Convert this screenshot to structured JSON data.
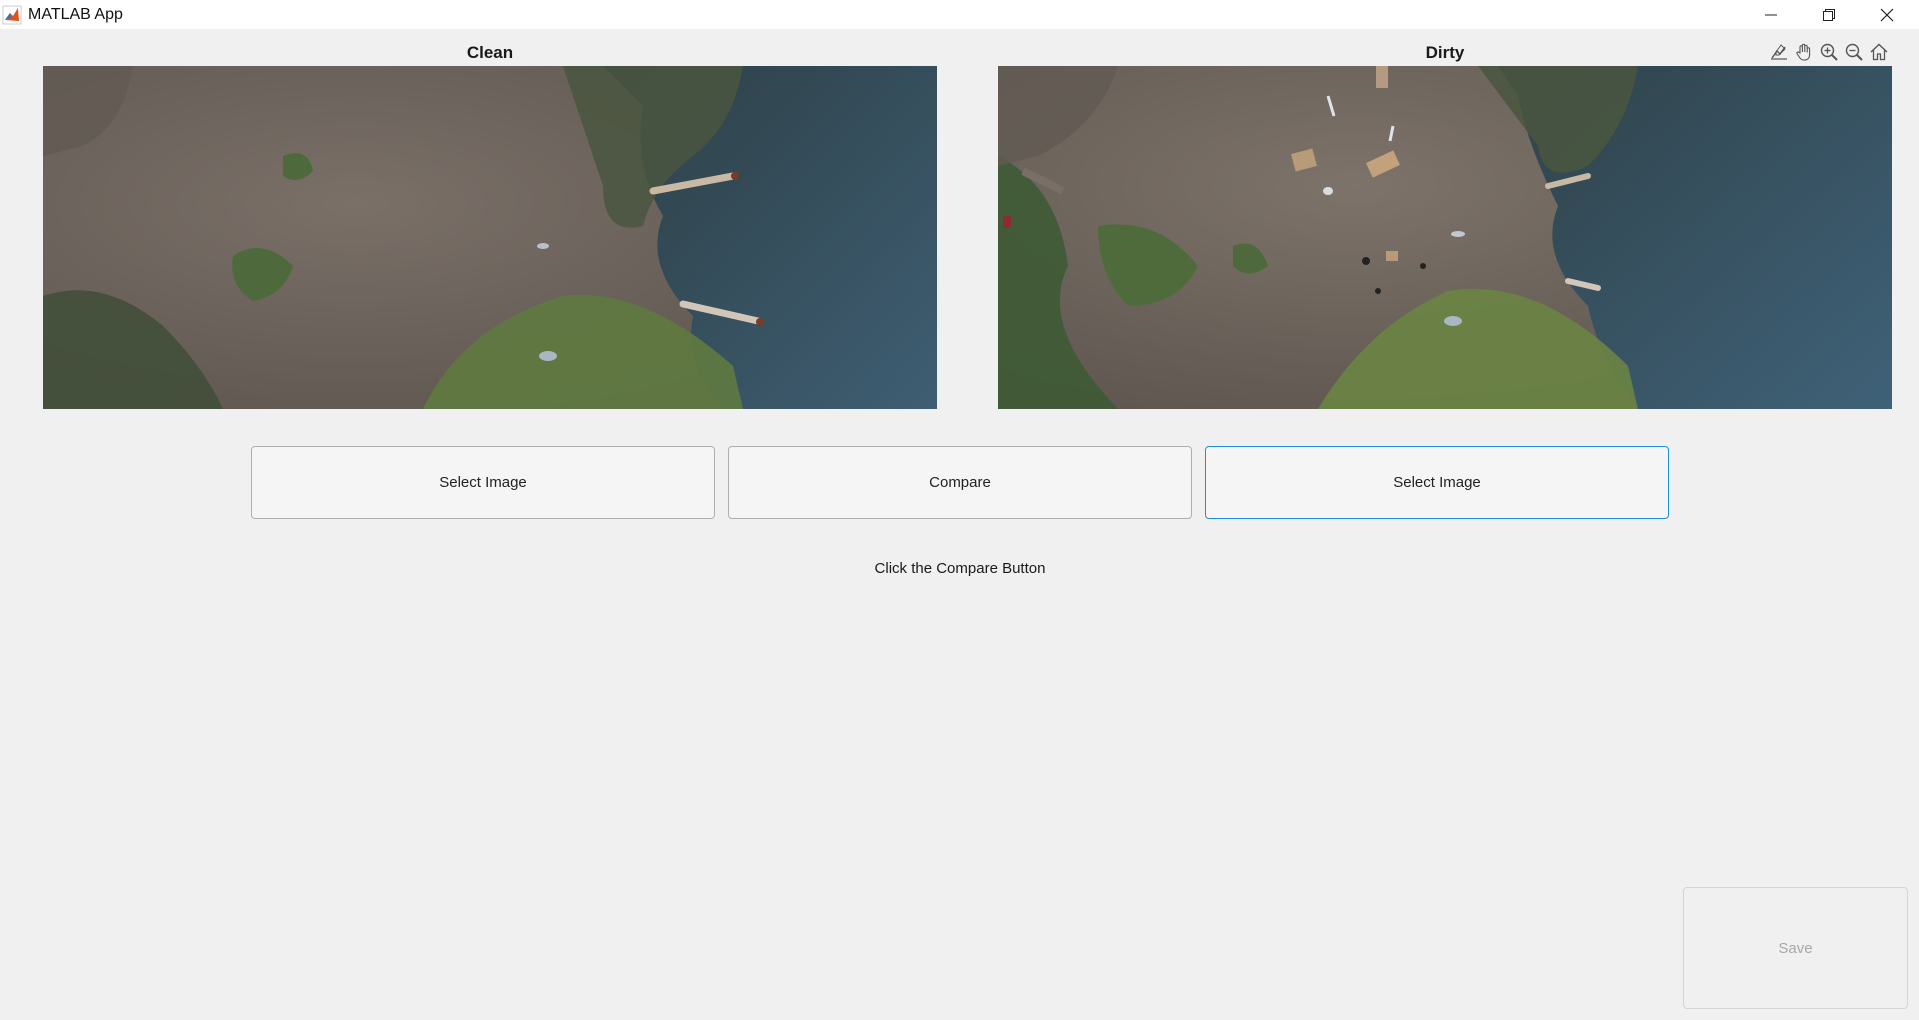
{
  "window": {
    "title": "MATLAB App",
    "controls": [
      "minimize-icon",
      "restore-icon",
      "close-icon"
    ]
  },
  "axes": {
    "left_title": "Clean",
    "right_title": "Dirty",
    "toolbar_icons": [
      "data-tips-icon",
      "pan-hand-icon",
      "zoom-in-icon",
      "zoom-out-icon",
      "home-icon"
    ]
  },
  "buttons": {
    "select_left": "Select Image",
    "compare": "Compare",
    "select_right": "Select Image",
    "save": "Save"
  },
  "status": {
    "message": "Click the Compare Button"
  },
  "colors": {
    "focus_border": "#1e90d8",
    "background": "#f0f0f0",
    "water": "#34505c",
    "ground": "#6b625a"
  }
}
